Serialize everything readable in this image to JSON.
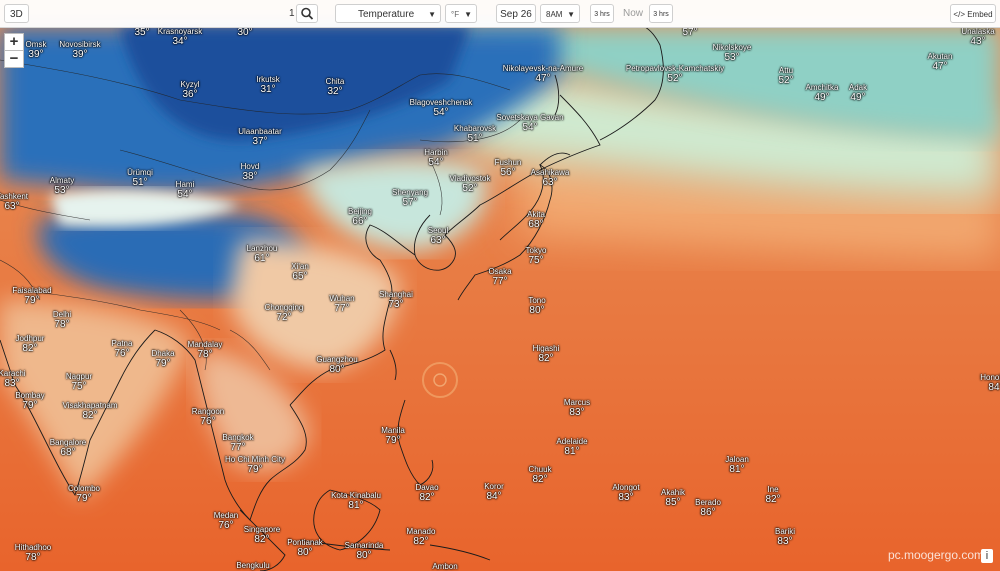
{
  "toolbar": {
    "view_3d": "3D",
    "layer_select": "Temperature",
    "unit_select": "°F",
    "date": "Sep 26",
    "time_select": "8AM",
    "step_back": "3 hrs",
    "now": "Now",
    "step_forward": "3 hrs",
    "embed": "</> Embed",
    "top_partial": "1"
  },
  "zoom": {
    "in": "+",
    "out": "−"
  },
  "watermark": "pc.moogergo.com",
  "info_label": "i",
  "colors": {
    "cold": "#1a5fb4",
    "cool": "#7ec8d8",
    "mild": "#bfe6c5",
    "warm": "#f0b070",
    "hot": "#ea7a38",
    "hotter": "#e8622b"
  },
  "cities": [
    {
      "name": "Omsk",
      "temp": "39°"
    },
    {
      "name": "Novosibirsk",
      "temp": "39°"
    },
    {
      "name": "Krasnoyarsk",
      "temp": "34°"
    },
    {
      "name": "",
      "temp": "35°"
    },
    {
      "name": "",
      "temp": "30°"
    },
    {
      "name": "Kyzyl",
      "temp": "36°"
    },
    {
      "name": "Irkutsk",
      "temp": "31°"
    },
    {
      "name": "Chita",
      "temp": "32°"
    },
    {
      "name": "Ulaanbaatar",
      "temp": "37°"
    },
    {
      "name": "Hovd",
      "temp": "38°"
    },
    {
      "name": "Ürümqi",
      "temp": "51°"
    },
    {
      "name": "Hami",
      "temp": "54°"
    },
    {
      "name": "Almaty",
      "temp": "53°"
    },
    {
      "name": "Tashkent",
      "temp": "63°"
    },
    {
      "name": "Lanzhou",
      "temp": "61°"
    },
    {
      "name": "Xi'an",
      "temp": "65°"
    },
    {
      "name": "Beijing",
      "temp": "66°"
    },
    {
      "name": "Shenyang",
      "temp": "57°"
    },
    {
      "name": "Harbin",
      "temp": "54°"
    },
    {
      "name": "Blagoveshchensk",
      "temp": "54°"
    },
    {
      "name": "Khabarovsk",
      "temp": "51°"
    },
    {
      "name": "Nikolayevsk-na-Amure",
      "temp": "47°"
    },
    {
      "name": "Sovetskaya Gavan",
      "temp": "54°"
    },
    {
      "name": "Vladivostok",
      "temp": "52°"
    },
    {
      "name": "Fushun",
      "temp": "56°"
    },
    {
      "name": "Seoul",
      "temp": "63°"
    },
    {
      "name": "Asahikawa",
      "temp": "63°"
    },
    {
      "name": "Akita",
      "temp": "68°"
    },
    {
      "name": "Tokyo",
      "temp": "75°"
    },
    {
      "name": "Osaka",
      "temp": "77°"
    },
    {
      "name": "Tono",
      "temp": "80°"
    },
    {
      "name": "Higashi",
      "temp": "82°"
    },
    {
      "name": "Petropavlovsk-Kamchatskiy",
      "temp": "52°"
    },
    {
      "name": "Nikolskoye",
      "temp": "53°"
    },
    {
      "name": "",
      "temp": "57°"
    },
    {
      "name": "Attu",
      "temp": "52°"
    },
    {
      "name": "Amchitka",
      "temp": "49°"
    },
    {
      "name": "Adak",
      "temp": "49°"
    },
    {
      "name": "Akutan",
      "temp": "47°"
    },
    {
      "name": "Unalaska",
      "temp": "43°"
    },
    {
      "name": "Faisalabad",
      "temp": "79°"
    },
    {
      "name": "Delhi",
      "temp": "78°"
    },
    {
      "name": "Jodhpur",
      "temp": "82°"
    },
    {
      "name": "Karachi",
      "temp": "83°"
    },
    {
      "name": "Patna",
      "temp": "76°"
    },
    {
      "name": "Dhaka",
      "temp": "79°"
    },
    {
      "name": "Nagpur",
      "temp": "75°"
    },
    {
      "name": "Bombay",
      "temp": "79°"
    },
    {
      "name": "Visakhapatnam",
      "temp": "82°"
    },
    {
      "name": "Bangalore",
      "temp": "68°"
    },
    {
      "name": "Colombo",
      "temp": "79°"
    },
    {
      "name": "Hithadhoo",
      "temp": "78°"
    },
    {
      "name": "Chongqing",
      "temp": "72°"
    },
    {
      "name": "Wuhan",
      "temp": "77°"
    },
    {
      "name": "Shanghai",
      "temp": "73°"
    },
    {
      "name": "Guangzhou",
      "temp": "80°"
    },
    {
      "name": "Mandalay",
      "temp": "78°"
    },
    {
      "name": "Rangoon",
      "temp": "76°"
    },
    {
      "name": "Bangkok",
      "temp": "77°"
    },
    {
      "name": "Ho Chi Minh City",
      "temp": "79°"
    },
    {
      "name": "Manila",
      "temp": "79°"
    },
    {
      "name": "Davao",
      "temp": "82°"
    },
    {
      "name": "Kota Kinabalu",
      "temp": "81°"
    },
    {
      "name": "Medan",
      "temp": "76°"
    },
    {
      "name": "Singapore",
      "temp": "82°"
    },
    {
      "name": "Pontianak",
      "temp": "80°"
    },
    {
      "name": "Samarinda",
      "temp": "80°"
    },
    {
      "name": "Manado",
      "temp": "82°"
    },
    {
      "name": "Marcus",
      "temp": "83°"
    },
    {
      "name": "Adelaide",
      "temp": "81°"
    },
    {
      "name": "Chuuk",
      "temp": "82°"
    },
    {
      "name": "Koror",
      "temp": "84°"
    },
    {
      "name": "Alongot",
      "temp": "83°"
    },
    {
      "name": "Akahik",
      "temp": "85°"
    },
    {
      "name": "Berado",
      "temp": "86°"
    },
    {
      "name": "Jaloan",
      "temp": "81°"
    },
    {
      "name": "Ine",
      "temp": "82°"
    },
    {
      "name": "Bariki",
      "temp": "83°"
    },
    {
      "name": "Honolulu",
      "temp": "84°"
    },
    {
      "name": "Bengkulu",
      "temp": ""
    },
    {
      "name": "Ambon",
      "temp": ""
    }
  ]
}
